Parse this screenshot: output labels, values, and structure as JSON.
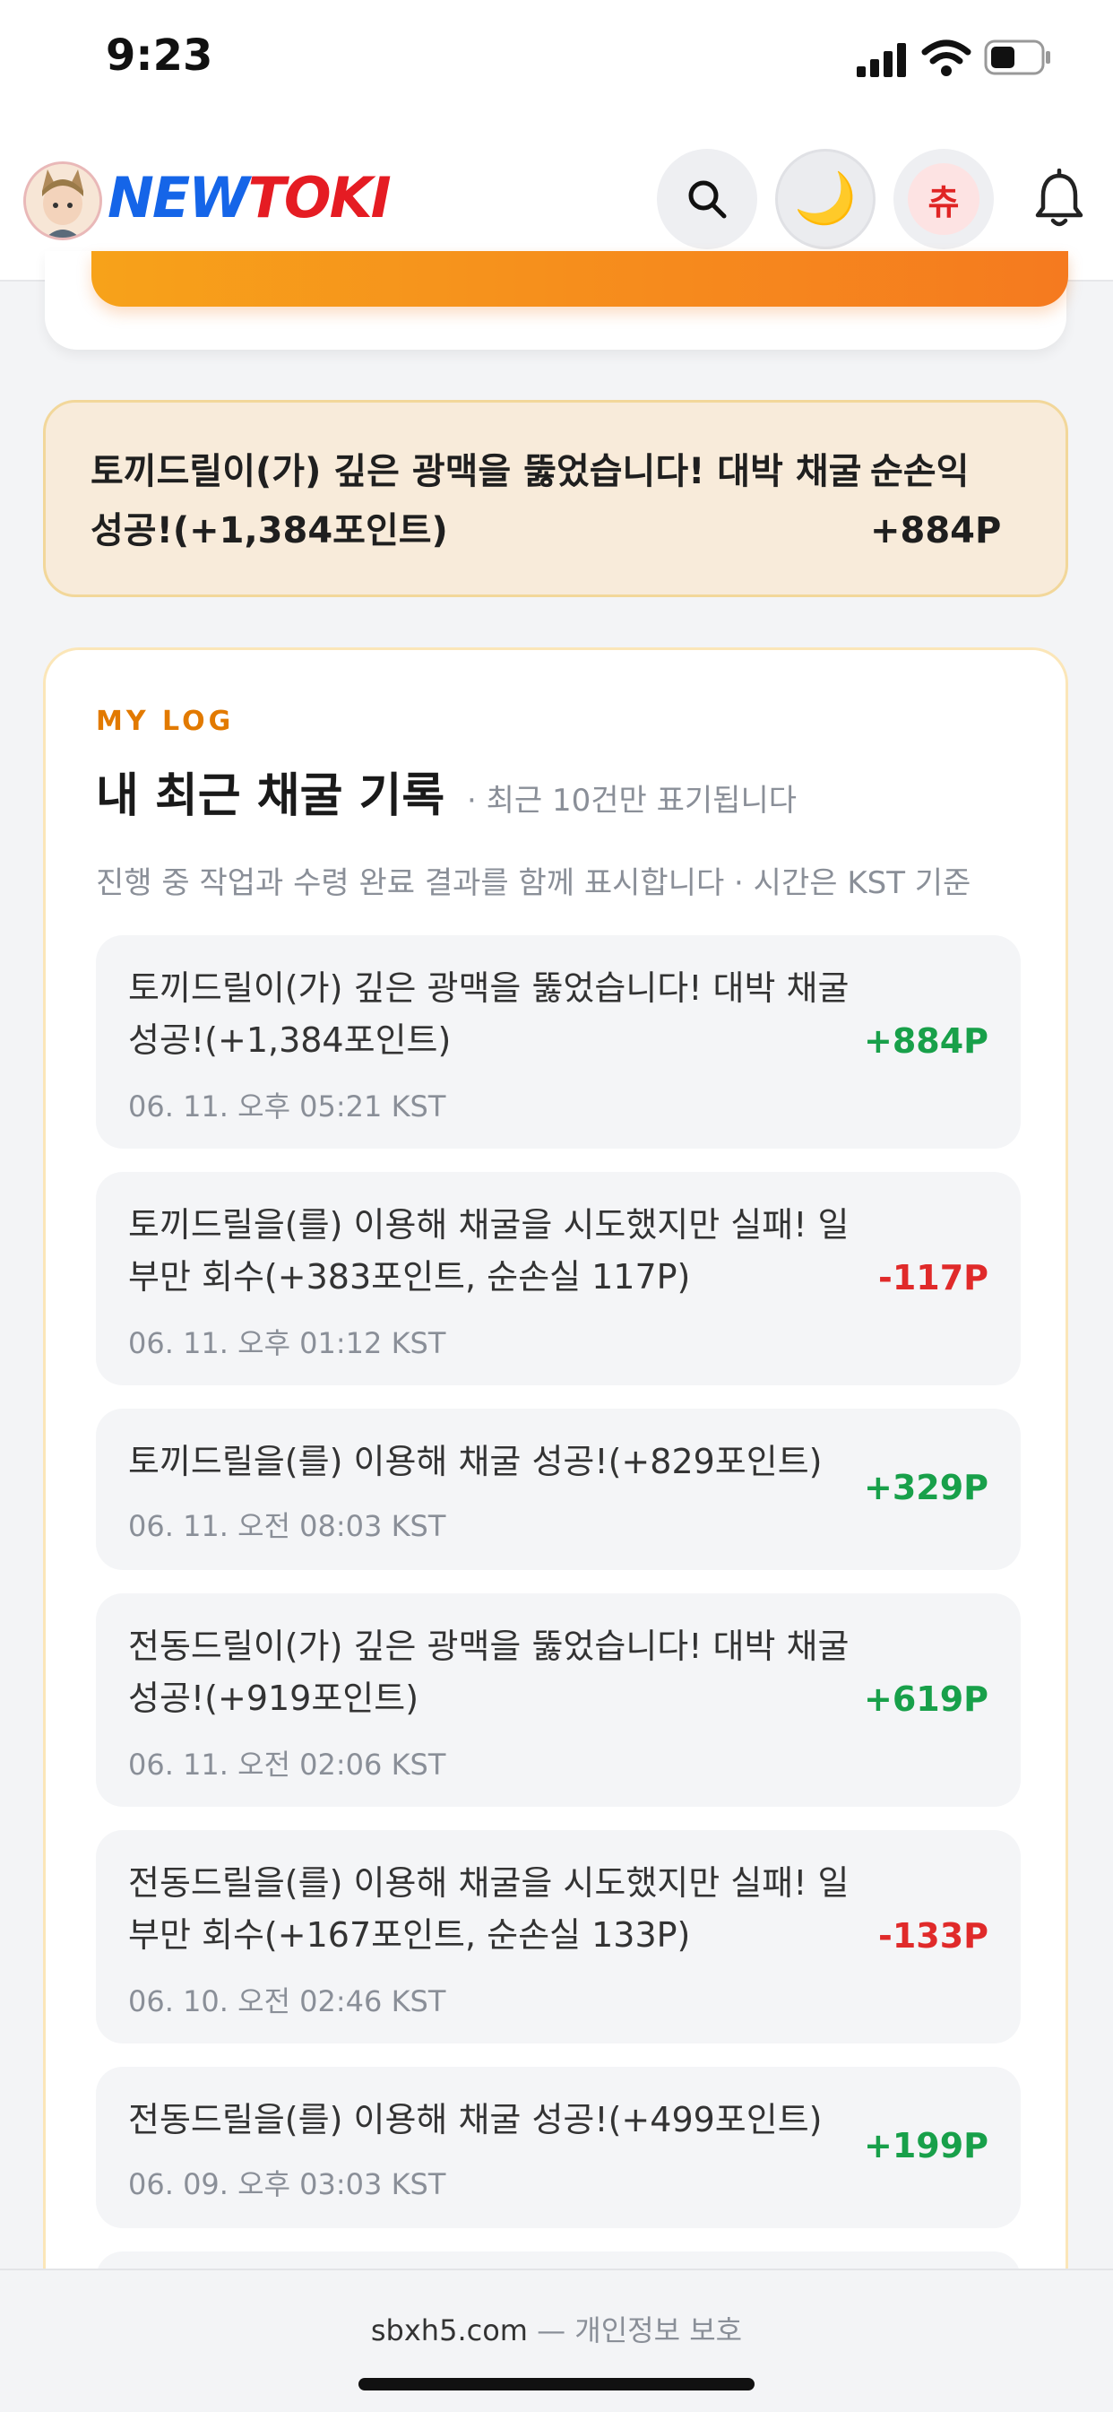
{
  "status": {
    "time": "9:23"
  },
  "header": {
    "logo_new": "NEW",
    "logo_toki": "TOKI",
    "moon_glyph": "🌙",
    "user_badge": "츄"
  },
  "banner": {
    "message": "토끼드릴이(가) 깊은 광맥을 뚫었습니다! 대박 채굴 성공!(+1,384포인트)",
    "net_label": "순손익",
    "net_value": "+884P"
  },
  "log": {
    "eyebrow": "MY LOG",
    "title": "내 최근 채굴 기록",
    "subtitle": "· 최근 10건만 표기됩니다",
    "description": "진행 중 작업과 수령 완료 결과를 함께 표시합니다 · 시간은 KST 기준",
    "entries": [
      {
        "message": "토끼드릴이(가) 깊은 광맥을 뚫었습니다! 대박 채굴 성공!(+1,384포인트)",
        "time": "06. 11. 오후 05:21 KST",
        "amount": "+884P",
        "positive": true
      },
      {
        "message": "토끼드릴을(를) 이용해 채굴을 시도했지만 실패! 일부만 회수(+383포인트, 순손실 117P)",
        "time": "06. 11. 오후 01:12 KST",
        "amount": "-117P",
        "positive": false
      },
      {
        "message": "토끼드릴을(를) 이용해 채굴 성공!(+829포인트)",
        "time": "06. 11. 오전 08:03 KST",
        "amount": "+329P",
        "positive": true
      },
      {
        "message": "전동드릴이(가) 깊은 광맥을 뚫었습니다! 대박 채굴 성공!(+919포인트)",
        "time": "06. 11. 오전 02:06 KST",
        "amount": "+619P",
        "positive": true
      },
      {
        "message": "전동드릴을(를) 이용해 채굴을 시도했지만 실패! 일부만 회수(+167포인트, 순손실 133P)",
        "time": "06. 10. 오전 02:46 KST",
        "amount": "-133P",
        "positive": false
      },
      {
        "message": "전동드릴을(를) 이용해 채굴 성공!(+499포인트)",
        "time": "06. 09. 오후 03:03 KST",
        "amount": "+199P",
        "positive": true
      }
    ]
  },
  "footer": {
    "domain": "sbxh5.com",
    "separator": "—",
    "privacy_link": "개인정보 보호"
  },
  "colors": {
    "positive": "#18a04a",
    "negative": "#e02a2a",
    "accent_orange": "#f57a1f",
    "logo_blue": "#1565e8",
    "logo_red": "#e51c23"
  },
  "icons": [
    "signal-icon",
    "wifi-icon",
    "battery-icon",
    "search-icon",
    "moon-icon",
    "bell-icon"
  ]
}
